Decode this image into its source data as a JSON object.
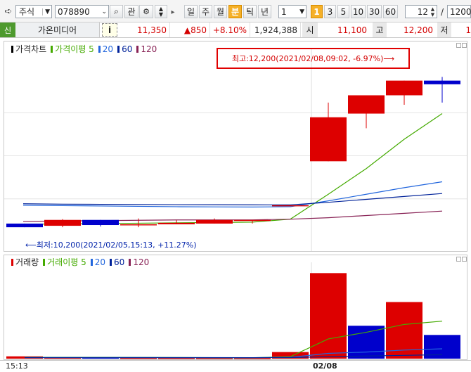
{
  "toolbar": {
    "market_select": "주식",
    "code_input": "078890",
    "gwan_label": "관",
    "period_buttons": [
      "일",
      "주",
      "월",
      "분",
      "틱",
      "년"
    ],
    "active_period": "분",
    "count_select": "1",
    "interval_buttons": [
      "1",
      "3",
      "5",
      "10",
      "30",
      "60"
    ],
    "active_interval": "1",
    "zoom_value": "12",
    "slash": "/",
    "total_value": "1200"
  },
  "infobar": {
    "badge": "신",
    "stock_name": "가온미디어",
    "info_button": "i",
    "price": "11,350",
    "change": "▲850",
    "change_pct": "+8.10%",
    "volume": "1,924,388",
    "open_label": "시",
    "open_value": "11,100",
    "high_label": "고",
    "high_value": "12,200",
    "low_label": "저",
    "low_value_partial": "1"
  },
  "price_panel": {
    "legend_title": "가격차트",
    "ma_title": "가격이평 5",
    "ma_periods": [
      "20",
      "60",
      "120"
    ],
    "high_annotation": "최고:12,200(2021/02/08,09:02, -6.97%)⟶",
    "low_annotation": "⟵최저:10,200(2021/02/05,15:13, +11.27%)"
  },
  "volume_panel": {
    "legend_title": "거래량",
    "ma_title": "거래이평 5",
    "ma_periods": [
      "20",
      "60",
      "120"
    ]
  },
  "time_axis": {
    "labels": [
      "15:13",
      "02/08"
    ]
  },
  "colors": {
    "up": "#dd0000",
    "down": "#0000cc",
    "ma5": "#44aa00",
    "ma20": "#2266dd",
    "ma60": "#002299",
    "ma120": "#882255",
    "annotation_box": "#e00000"
  },
  "chart_data": {
    "type": "candlestick",
    "note_units": "price in KRW, volume in shares",
    "candles": [
      {
        "o": 10250,
        "h": 10250,
        "l": 10200,
        "c": 10200
      },
      {
        "o": 10220,
        "h": 10310,
        "l": 10200,
        "c": 10300
      },
      {
        "o": 10300,
        "h": 10300,
        "l": 10210,
        "c": 10230
      },
      {
        "o": 10240,
        "h": 10320,
        "l": 10200,
        "c": 10240
      },
      {
        "o": 10240,
        "h": 10300,
        "l": 10240,
        "c": 10260
      },
      {
        "o": 10250,
        "h": 10320,
        "l": 10250,
        "c": 10300
      },
      {
        "o": 10300,
        "h": 10300,
        "l": 10250,
        "c": 10300
      },
      {
        "o": 10500,
        "h": 10500,
        "l": 10500,
        "c": 10500
      },
      {
        "o": 11100,
        "h": 11900,
        "l": 11100,
        "c": 11700
      },
      {
        "o": 11750,
        "h": 11900,
        "l": 11550,
        "c": 12000
      },
      {
        "o": 12000,
        "h": 12200,
        "l": 11870,
        "c": 12200
      },
      {
        "o": 12200,
        "h": 12250,
        "l": 11900,
        "c": 12150
      }
    ],
    "price_ylim": [
      10000,
      12350
    ],
    "ma_lines": [
      {
        "name": "5",
        "values": [
          10240,
          10245,
          10250,
          10255,
          10260,
          10265,
          10270,
          10310,
          10650,
          11000,
          11400,
          11750
        ]
      },
      {
        "name": "20",
        "values": [
          10500,
          10495,
          10490,
          10485,
          10480,
          10478,
          10476,
          10480,
          10560,
          10650,
          10740,
          10820
        ]
      },
      {
        "name": "60",
        "values": [
          10520,
          10515,
          10512,
          10510,
          10508,
          10507,
          10506,
          10505,
          10540,
          10580,
          10620,
          10660
        ]
      },
      {
        "name": "120",
        "values": [
          10280,
          10285,
          10290,
          10295,
          10300,
          10300,
          10300,
          10310,
          10330,
          10360,
          10390,
          10420
        ]
      }
    ],
    "volume": [
      3500,
      1500,
      2000,
      1200,
      1100,
      1000,
      1000,
      10000,
      130000,
      50000,
      86000,
      36000
    ],
    "volume_up": [
      true,
      true,
      false,
      true,
      true,
      true,
      true,
      true,
      true,
      false,
      true,
      false
    ],
    "volume_ylim": [
      0,
      140000
    ],
    "volume_ma": [
      {
        "name": "5",
        "values": [
          2000,
          2000,
          2000,
          1900,
          1800,
          1500,
          1300,
          3000,
          30000,
          40000,
          52000,
          57000
        ]
      },
      {
        "name": "20",
        "values": [
          1800,
          1800,
          1800,
          1700,
          1600,
          1600,
          1500,
          2000,
          8000,
          10000,
          13000,
          15000
        ]
      },
      {
        "name": "60",
        "values": [
          1500,
          1500,
          1500,
          1500,
          1500,
          1500,
          1500,
          1600,
          3000,
          4000,
          5000,
          6000
        ]
      }
    ]
  }
}
